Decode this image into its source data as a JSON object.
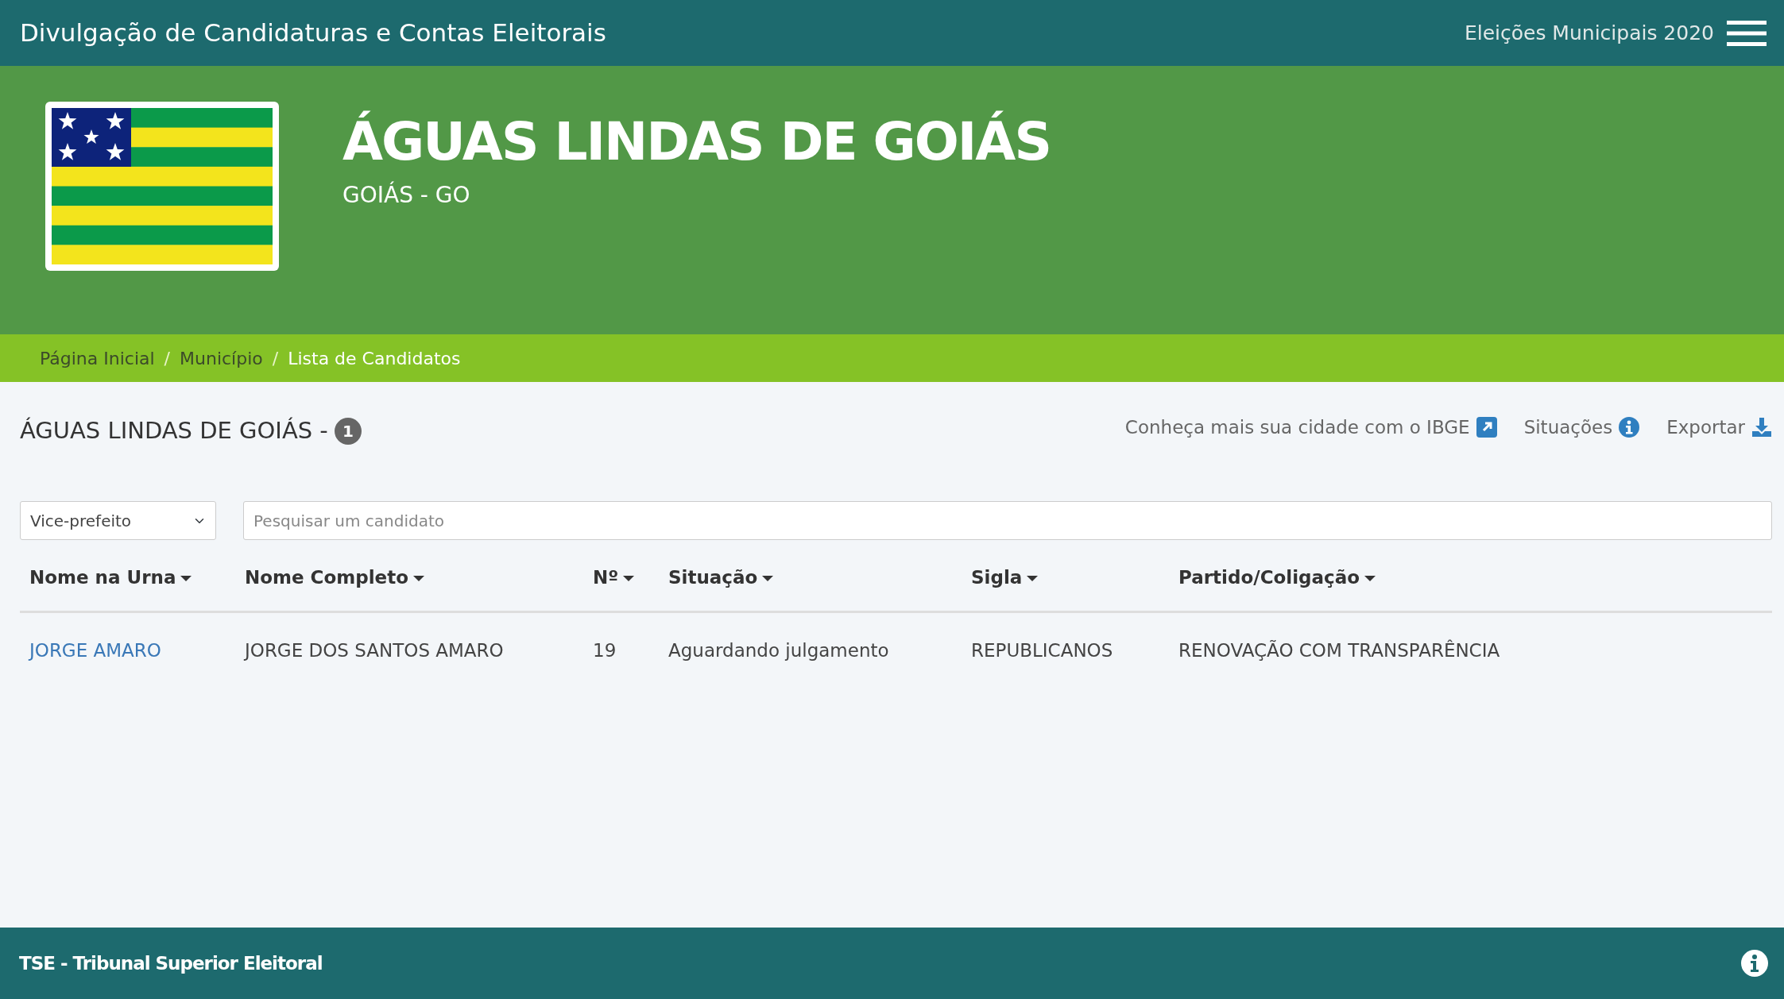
{
  "navbar": {
    "title": "Divulgação de Candidaturas e Contas Eleitorais",
    "election": "Eleições Municipais 2020"
  },
  "header": {
    "city": "ÁGUAS LINDAS DE GOIÁS",
    "state": "GOIÁS - GO"
  },
  "breadcrumb": {
    "separator": "/",
    "items": [
      {
        "label": "Página Inicial",
        "selected": false
      },
      {
        "label": "Município",
        "selected": false
      },
      {
        "label": "Lista de Candidatos",
        "selected": true
      }
    ]
  },
  "heading": {
    "title": "ÁGUAS LINDAS DE GOIÁS -",
    "count": "1"
  },
  "links": [
    {
      "label": "Conheça mais sua cidade com o IBGE",
      "kind": "external"
    },
    {
      "label": "Situações",
      "kind": "info"
    },
    {
      "label": "Exportar",
      "kind": "download"
    }
  ],
  "filter": {
    "value": "Vice-prefeito"
  },
  "search": {
    "placeholder": "Pesquisar um candidato"
  },
  "table": {
    "columns": [
      "Nome na Urna",
      "Nome Completo",
      "Nº",
      "Situação",
      "Sigla",
      "Partido/Coligação"
    ],
    "rows": [
      [
        "JORGE AMARO",
        "JORGE DOS SANTOS AMARO",
        "19",
        "Aguardando julgamento",
        "REPUBLICANOS",
        "RENOVAÇÃO COM TRANSPARÊNCIA"
      ]
    ]
  },
  "footer": {
    "text": "TSE - Tribunal Superior Eleitoral"
  }
}
